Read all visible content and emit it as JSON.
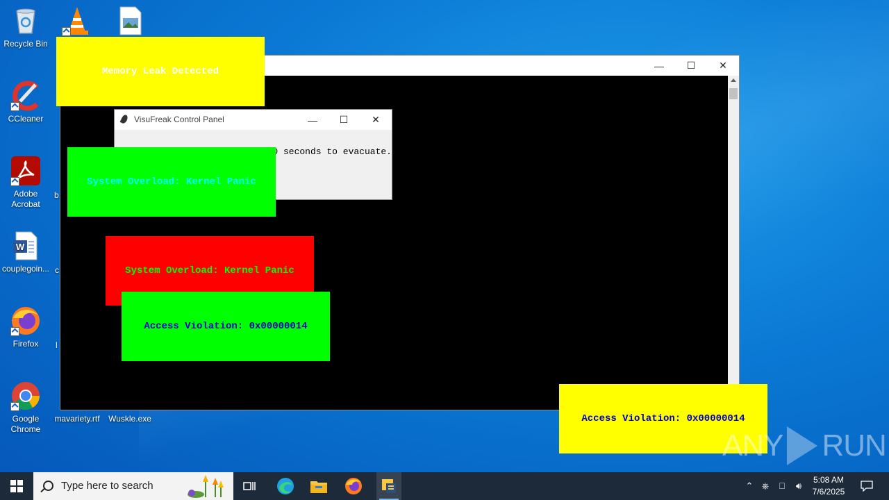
{
  "desktop": {
    "icons": [
      {
        "label": "Recycle Bin"
      },
      {
        "label": "CCleaner"
      },
      {
        "label": "Adobe Acrobat"
      },
      {
        "label": "couplegoin..."
      },
      {
        "label": "Firefox"
      },
      {
        "label": "Google Chrome"
      },
      {
        "label": "mavariety.rtf"
      },
      {
        "label": "Wuskle.exe"
      }
    ],
    "partial_labels": {
      "b": "b",
      "c": "c",
      "l": "l"
    }
  },
  "main_window": {
    "minimize": "—",
    "maximize": "☐",
    "close": "✕"
  },
  "control_panel": {
    "title": "VisuFreak Control Panel",
    "message": "0 seconds to evacuate.",
    "minimize": "—",
    "maximize": "☐",
    "close": "✕"
  },
  "popups": [
    {
      "text": "Memory Leak Detected",
      "bg": "#ffff00",
      "fg": "#ffffff"
    },
    {
      "text": "System Overload: Kernel Panic",
      "bg": "#00ff00",
      "fg": "#00ffff"
    },
    {
      "text": "System Overload: Kernel Panic",
      "bg": "#ff0000",
      "fg": "#00ff00"
    },
    {
      "text": "Access Violation: 0x00000014",
      "bg": "#00ff00",
      "fg": "#0000cc"
    },
    {
      "text": "Access Violation: 0x00000014",
      "bg": "#ffff00",
      "fg": "#0000cc"
    }
  ],
  "watermark": {
    "left": "ANY",
    "right": "RUN"
  },
  "taskbar": {
    "search_placeholder": "Type here to search",
    "time": "5:08 AM",
    "date": "7/6/2025"
  }
}
